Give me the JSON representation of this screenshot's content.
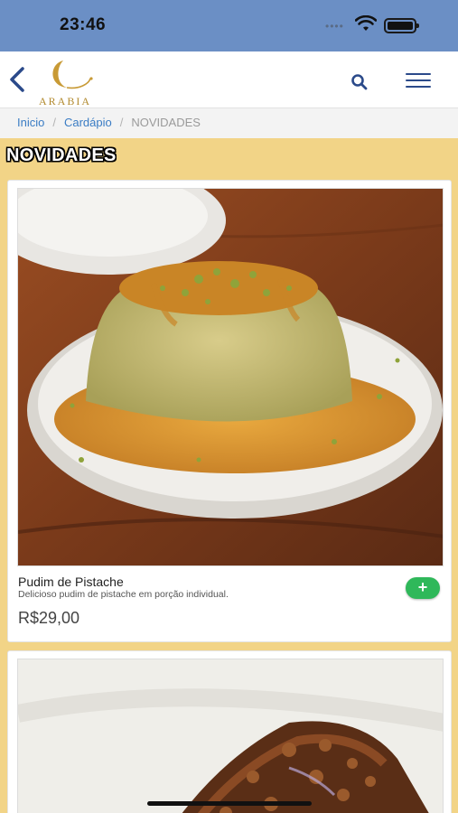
{
  "status_bar": {
    "time": "23:46",
    "dots": "••••"
  },
  "header": {
    "logo_text": "ARABIA"
  },
  "breadcrumb": {
    "items": [
      "Inicio",
      "Cardápio"
    ],
    "current": "NOVIDADES"
  },
  "section": {
    "title": "NOVIDADES"
  },
  "products": [
    {
      "name": "Pudim de Pistache",
      "description": "Delicioso pudim de pistache em porção individual.",
      "price": "R$29,00",
      "add_label": "+"
    }
  ],
  "icons": {
    "back": "chevron-left-icon",
    "search": "search-icon",
    "menu": "hamburger-menu-icon",
    "add": "plus-icon",
    "wifi": "wifi-icon",
    "battery": "battery-icon"
  },
  "colors": {
    "status_bar": "#6b8fc5",
    "page_background": "#f2d487",
    "nav_accent": "#2b4a8a",
    "link": "#3a7cc4",
    "add_button": "#2fb85a",
    "logo_gold": "#b28a2e"
  }
}
